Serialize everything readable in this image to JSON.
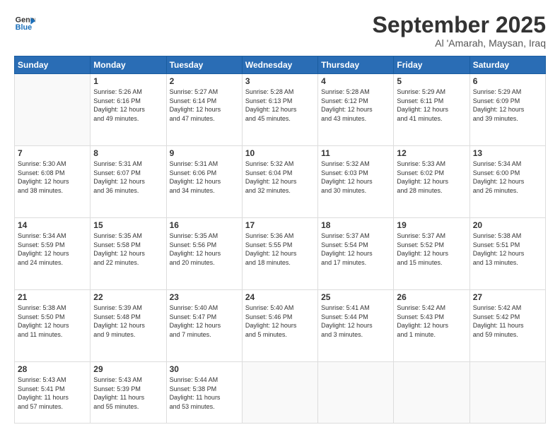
{
  "header": {
    "logo_line1": "General",
    "logo_line2": "Blue",
    "month": "September 2025",
    "location": "Al 'Amarah, Maysan, Iraq"
  },
  "weekdays": [
    "Sunday",
    "Monday",
    "Tuesday",
    "Wednesday",
    "Thursday",
    "Friday",
    "Saturday"
  ],
  "weeks": [
    [
      {
        "day": "",
        "info": ""
      },
      {
        "day": "1",
        "info": "Sunrise: 5:26 AM\nSunset: 6:16 PM\nDaylight: 12 hours\nand 49 minutes."
      },
      {
        "day": "2",
        "info": "Sunrise: 5:27 AM\nSunset: 6:14 PM\nDaylight: 12 hours\nand 47 minutes."
      },
      {
        "day": "3",
        "info": "Sunrise: 5:28 AM\nSunset: 6:13 PM\nDaylight: 12 hours\nand 45 minutes."
      },
      {
        "day": "4",
        "info": "Sunrise: 5:28 AM\nSunset: 6:12 PM\nDaylight: 12 hours\nand 43 minutes."
      },
      {
        "day": "5",
        "info": "Sunrise: 5:29 AM\nSunset: 6:11 PM\nDaylight: 12 hours\nand 41 minutes."
      },
      {
        "day": "6",
        "info": "Sunrise: 5:29 AM\nSunset: 6:09 PM\nDaylight: 12 hours\nand 39 minutes."
      }
    ],
    [
      {
        "day": "7",
        "info": "Sunrise: 5:30 AM\nSunset: 6:08 PM\nDaylight: 12 hours\nand 38 minutes."
      },
      {
        "day": "8",
        "info": "Sunrise: 5:31 AM\nSunset: 6:07 PM\nDaylight: 12 hours\nand 36 minutes."
      },
      {
        "day": "9",
        "info": "Sunrise: 5:31 AM\nSunset: 6:06 PM\nDaylight: 12 hours\nand 34 minutes."
      },
      {
        "day": "10",
        "info": "Sunrise: 5:32 AM\nSunset: 6:04 PM\nDaylight: 12 hours\nand 32 minutes."
      },
      {
        "day": "11",
        "info": "Sunrise: 5:32 AM\nSunset: 6:03 PM\nDaylight: 12 hours\nand 30 minutes."
      },
      {
        "day": "12",
        "info": "Sunrise: 5:33 AM\nSunset: 6:02 PM\nDaylight: 12 hours\nand 28 minutes."
      },
      {
        "day": "13",
        "info": "Sunrise: 5:34 AM\nSunset: 6:00 PM\nDaylight: 12 hours\nand 26 minutes."
      }
    ],
    [
      {
        "day": "14",
        "info": "Sunrise: 5:34 AM\nSunset: 5:59 PM\nDaylight: 12 hours\nand 24 minutes."
      },
      {
        "day": "15",
        "info": "Sunrise: 5:35 AM\nSunset: 5:58 PM\nDaylight: 12 hours\nand 22 minutes."
      },
      {
        "day": "16",
        "info": "Sunrise: 5:35 AM\nSunset: 5:56 PM\nDaylight: 12 hours\nand 20 minutes."
      },
      {
        "day": "17",
        "info": "Sunrise: 5:36 AM\nSunset: 5:55 PM\nDaylight: 12 hours\nand 18 minutes."
      },
      {
        "day": "18",
        "info": "Sunrise: 5:37 AM\nSunset: 5:54 PM\nDaylight: 12 hours\nand 17 minutes."
      },
      {
        "day": "19",
        "info": "Sunrise: 5:37 AM\nSunset: 5:52 PM\nDaylight: 12 hours\nand 15 minutes."
      },
      {
        "day": "20",
        "info": "Sunrise: 5:38 AM\nSunset: 5:51 PM\nDaylight: 12 hours\nand 13 minutes."
      }
    ],
    [
      {
        "day": "21",
        "info": "Sunrise: 5:38 AM\nSunset: 5:50 PM\nDaylight: 12 hours\nand 11 minutes."
      },
      {
        "day": "22",
        "info": "Sunrise: 5:39 AM\nSunset: 5:48 PM\nDaylight: 12 hours\nand 9 minutes."
      },
      {
        "day": "23",
        "info": "Sunrise: 5:40 AM\nSunset: 5:47 PM\nDaylight: 12 hours\nand 7 minutes."
      },
      {
        "day": "24",
        "info": "Sunrise: 5:40 AM\nSunset: 5:46 PM\nDaylight: 12 hours\nand 5 minutes."
      },
      {
        "day": "25",
        "info": "Sunrise: 5:41 AM\nSunset: 5:44 PM\nDaylight: 12 hours\nand 3 minutes."
      },
      {
        "day": "26",
        "info": "Sunrise: 5:42 AM\nSunset: 5:43 PM\nDaylight: 12 hours\nand 1 minute."
      },
      {
        "day": "27",
        "info": "Sunrise: 5:42 AM\nSunset: 5:42 PM\nDaylight: 11 hours\nand 59 minutes."
      }
    ],
    [
      {
        "day": "28",
        "info": "Sunrise: 5:43 AM\nSunset: 5:41 PM\nDaylight: 11 hours\nand 57 minutes."
      },
      {
        "day": "29",
        "info": "Sunrise: 5:43 AM\nSunset: 5:39 PM\nDaylight: 11 hours\nand 55 minutes."
      },
      {
        "day": "30",
        "info": "Sunrise: 5:44 AM\nSunset: 5:38 PM\nDaylight: 11 hours\nand 53 minutes."
      },
      {
        "day": "",
        "info": ""
      },
      {
        "day": "",
        "info": ""
      },
      {
        "day": "",
        "info": ""
      },
      {
        "day": "",
        "info": ""
      }
    ]
  ]
}
